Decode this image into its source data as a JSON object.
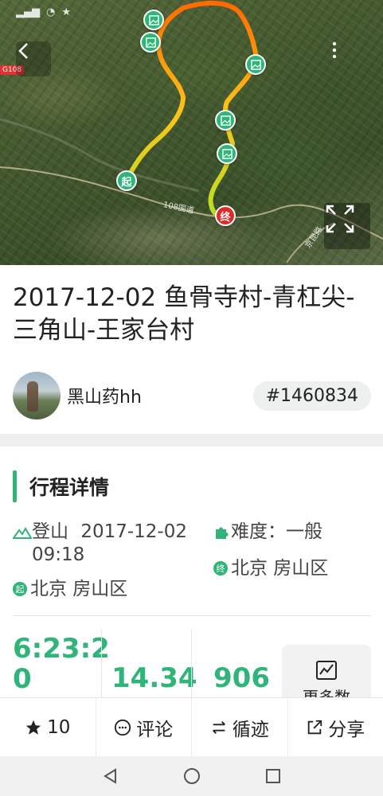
{
  "map": {
    "start_label": "起",
    "end_label": "终",
    "road_108": "108国道",
    "road_jing": "京昆路",
    "route_badge": "G108"
  },
  "title": "2017-12-02 鱼骨寺村-青杠尖-三角山-王家台村",
  "author": {
    "name": "黑山药hh",
    "trip_id": "#1460834"
  },
  "section": {
    "title": "行程详情"
  },
  "details": {
    "activity": "登山",
    "datetime_line1": "2017-12-02",
    "datetime_line2": "09:18",
    "difficulty": "难度：一般",
    "start_location": "北京 房山区",
    "end_location": "北京 房山区",
    "start_icon": "起",
    "end_icon": "终"
  },
  "stats": {
    "duration_line1": "6:23:2",
    "duration_line2": "0",
    "distance": "14.34",
    "elevation": "906",
    "more": "更多数"
  },
  "bottom": {
    "star_count": "10",
    "comment": "评论",
    "follow": "循迹",
    "share": "分享"
  },
  "colors": {
    "accent": "#2fb47a",
    "route_start": "#c9e020",
    "route_end": "#ff6a00"
  }
}
